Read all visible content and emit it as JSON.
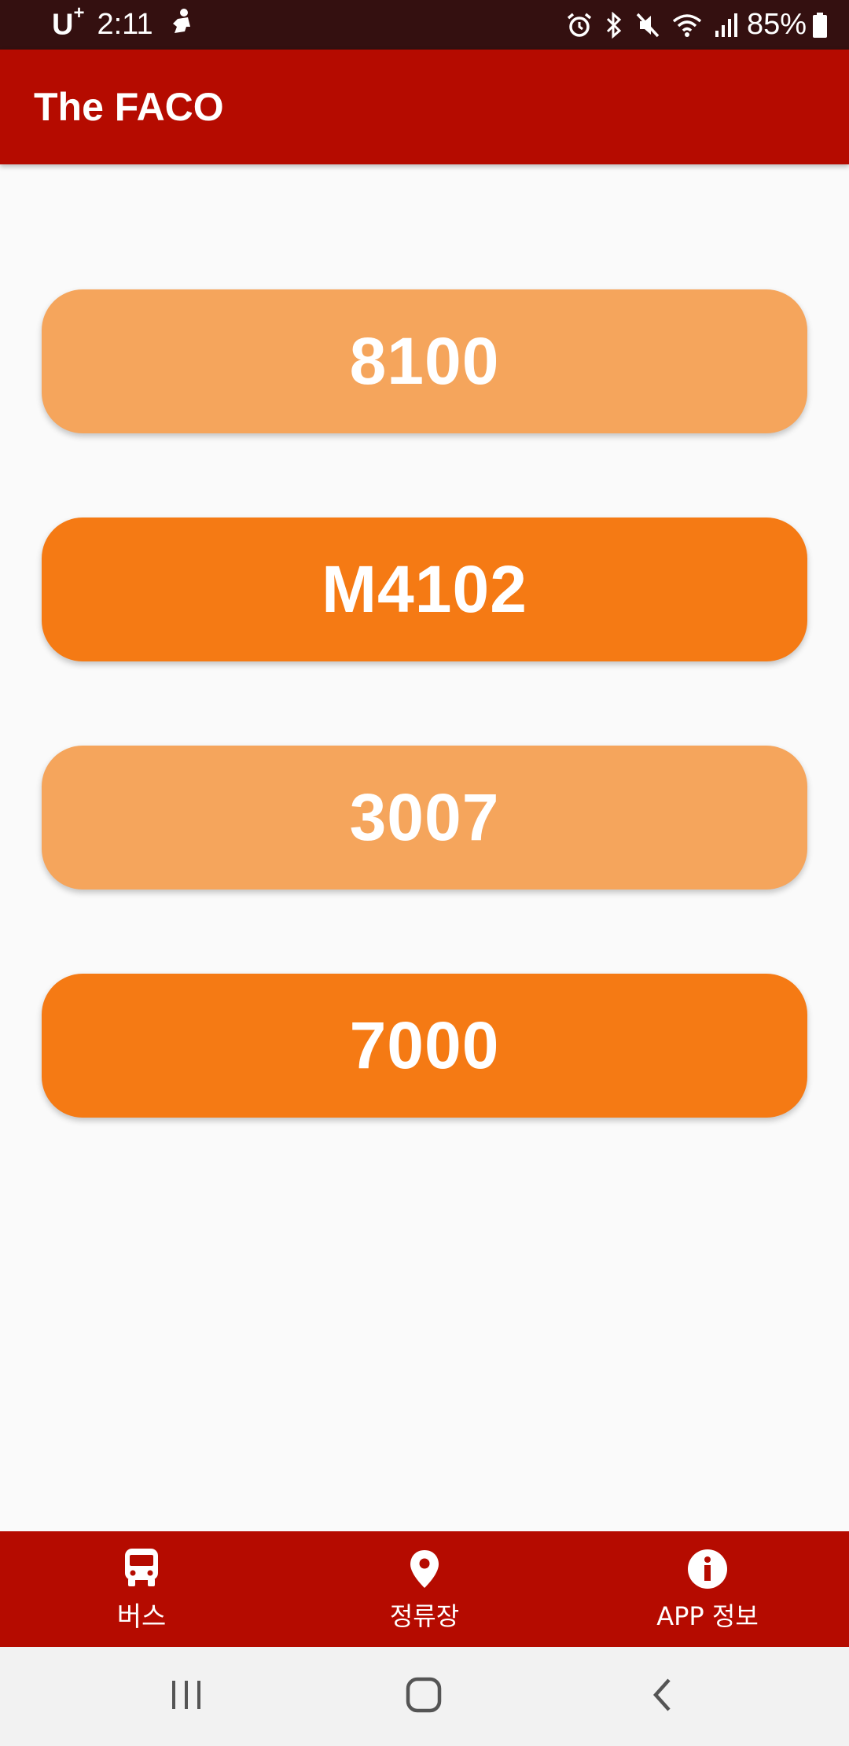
{
  "status_bar": {
    "carrier": "U",
    "carrier_plus": "+",
    "time": "2:11",
    "battery": "85%",
    "icons": [
      "person-icon",
      "alarm-icon",
      "bluetooth-icon",
      "mute-icon",
      "wifi-icon",
      "signal-icon",
      "battery-icon"
    ]
  },
  "app_bar": {
    "title": "The FACO"
  },
  "bus_buttons": [
    {
      "label": "8100",
      "color": "#f5a55c"
    },
    {
      "label": "M4102",
      "color": "#f57a14"
    },
    {
      "label": "3007",
      "color": "#f5a55c"
    },
    {
      "label": "7000",
      "color": "#f57a14"
    }
  ],
  "bottom_nav": {
    "items": [
      {
        "label": "버스",
        "icon": "bus-icon",
        "active": true
      },
      {
        "label": "정류장",
        "icon": "location-pin-icon",
        "active": false
      },
      {
        "label": "APP 정보",
        "icon": "info-icon",
        "active": false
      }
    ]
  },
  "system_nav": {
    "buttons": [
      "recents-icon",
      "home-icon",
      "back-icon"
    ]
  },
  "colors": {
    "status_bar": "#341010",
    "app_bar": "#b50b00",
    "button_light": "#f5a55c",
    "button_dark": "#f57a14",
    "background": "#fafafa",
    "system_nav": "#f2f2f2"
  }
}
